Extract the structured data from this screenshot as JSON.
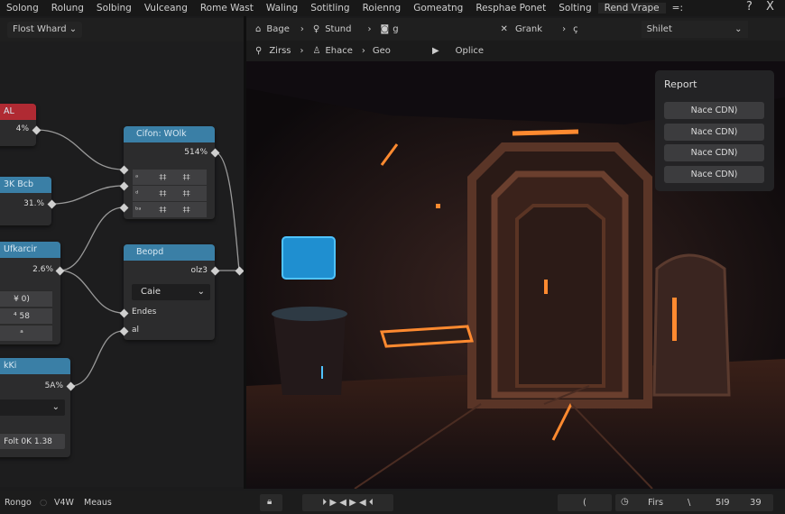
{
  "menu": {
    "items": [
      "Solong",
      "Rolung",
      "Solbing",
      "Vulceang",
      "Rome Wast",
      "Waling",
      "Sotitling",
      "Roienng",
      "Gomeatng",
      "Resphae Ponet",
      "Solting",
      "Rend Vrape"
    ],
    "extra": "=:",
    "help": "?",
    "close": "X"
  },
  "left_toolbar": {
    "dropdown": "Flost Whard"
  },
  "viewport_toolbar": {
    "row1": {
      "crumb1": "Bage",
      "crumb2": "Stund",
      "crumb3": "g",
      "crumb4": "Grank",
      "crumb5": "ç",
      "select": "Shilet"
    },
    "row2": {
      "crumb1": "Zirss",
      "crumb2": "Ehace",
      "crumb3": "Geo",
      "action": "Oplice"
    }
  },
  "nodes": {
    "a": {
      "header": "AL",
      "output": "4%"
    },
    "b": {
      "header": "3K Bcb",
      "output": "31.%"
    },
    "c": {
      "header": "Ufkarcir",
      "output": "2.6%",
      "fields": [
        "¥ 0)",
        "⁴ 58",
        "ᵃ"
      ]
    },
    "d": {
      "header": "kKi",
      "output": "5A%",
      "select": "",
      "field": "Folt  0K  1.38"
    },
    "e": {
      "header": "Cifon: WOlk",
      "output": "514%",
      "grid": [
        [
          "ᵃ",
          "‡‡",
          "‡‡"
        ],
        [
          "ᵈ",
          "‡‡",
          "‡‡"
        ],
        [
          "ᵇᵃ",
          "‡‡",
          "‡‡"
        ]
      ]
    },
    "f": {
      "header": "Beopd",
      "output": "olz3",
      "select": "Caie",
      "inputs": [
        "Endes",
        "al"
      ]
    }
  },
  "report": {
    "title": "Report",
    "buttons": [
      "Nace CDN)",
      "Nace CDN)",
      "Nace CDN)",
      "Nace CDN)"
    ]
  },
  "bottom": {
    "left": [
      "Rongo",
      "V4W",
      "Meaus"
    ],
    "right_prev": "(",
    "right_label": "Firs",
    "right_sep": "\\",
    "right_num1": "5I9",
    "right_num2": "39"
  },
  "colors": {
    "node_header": "#3a7fa6",
    "node_header_alert": "#b02a33",
    "accent_light": "#ff7a2a",
    "screen": "#2aa0e0"
  }
}
